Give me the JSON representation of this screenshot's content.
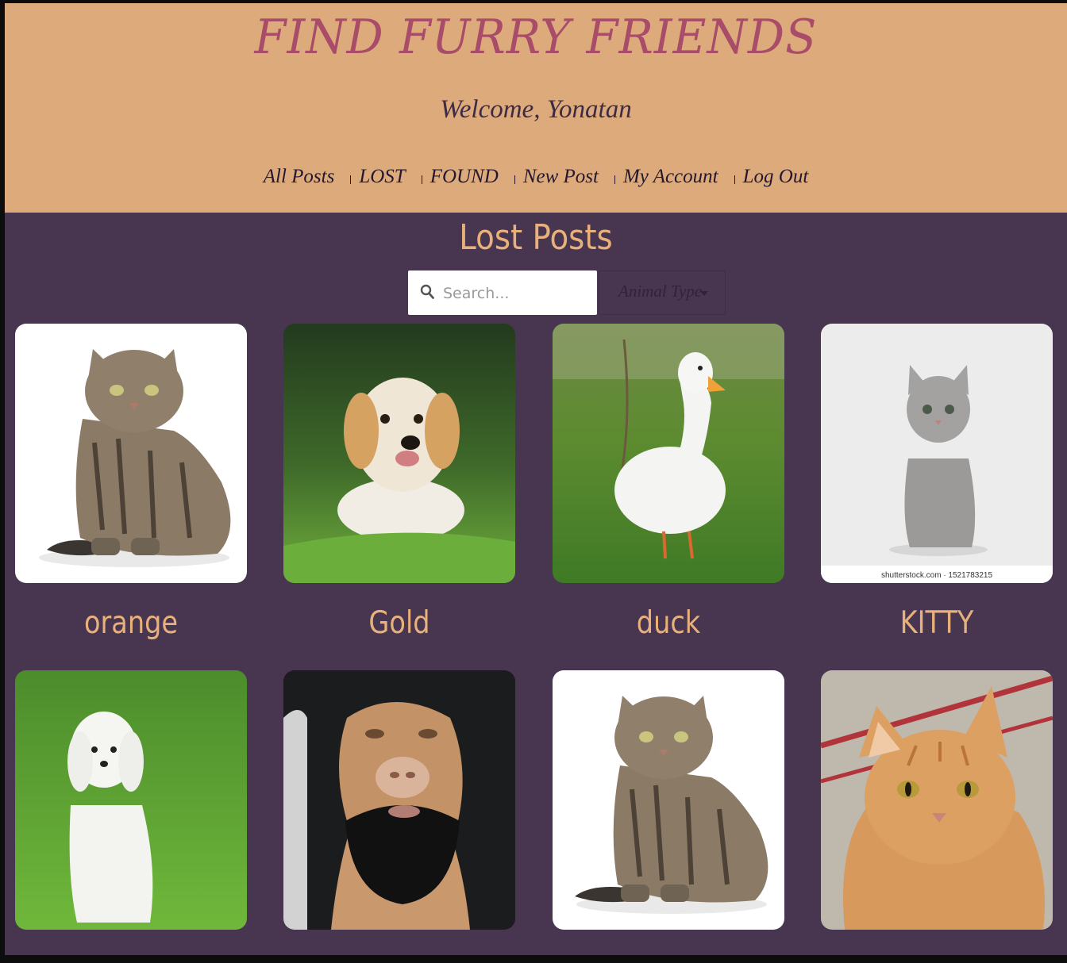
{
  "site": {
    "title": "FIND FURRY FRIENDS",
    "welcome": "Welcome, Yonatan"
  },
  "nav": {
    "items": [
      {
        "label": "All Posts"
      },
      {
        "label": "LOST"
      },
      {
        "label": "FOUND"
      },
      {
        "label": "New Post"
      },
      {
        "label": "My Account"
      },
      {
        "label": "Log Out"
      }
    ]
  },
  "page": {
    "heading": "Lost Posts"
  },
  "search": {
    "placeholder": "Search...",
    "value": ""
  },
  "filter": {
    "animal_type_label": "Animal Type"
  },
  "posts": [
    {
      "caption": "orange",
      "image": "tabby-cat-photo"
    },
    {
      "caption": "Gold",
      "image": "golden-retriever-puppy-photo"
    },
    {
      "caption": "duck",
      "image": "white-duck-photo"
    },
    {
      "caption": "KITTY",
      "image": "grey-kitten-photo",
      "watermark": "shutterstock.com · 1521783215"
    },
    {
      "caption": "",
      "image": "white-maltese-dog-photo"
    },
    {
      "caption": "",
      "image": "pitbull-beard-photo"
    },
    {
      "caption": "",
      "image": "tabby-cat-photo"
    },
    {
      "caption": "",
      "image": "orange-cat-photo"
    }
  ],
  "colors": {
    "header_bg": "#ddab7b",
    "body_bg": "#483650",
    "title": "#a94c6a",
    "accent_text": "#e8b07b"
  }
}
